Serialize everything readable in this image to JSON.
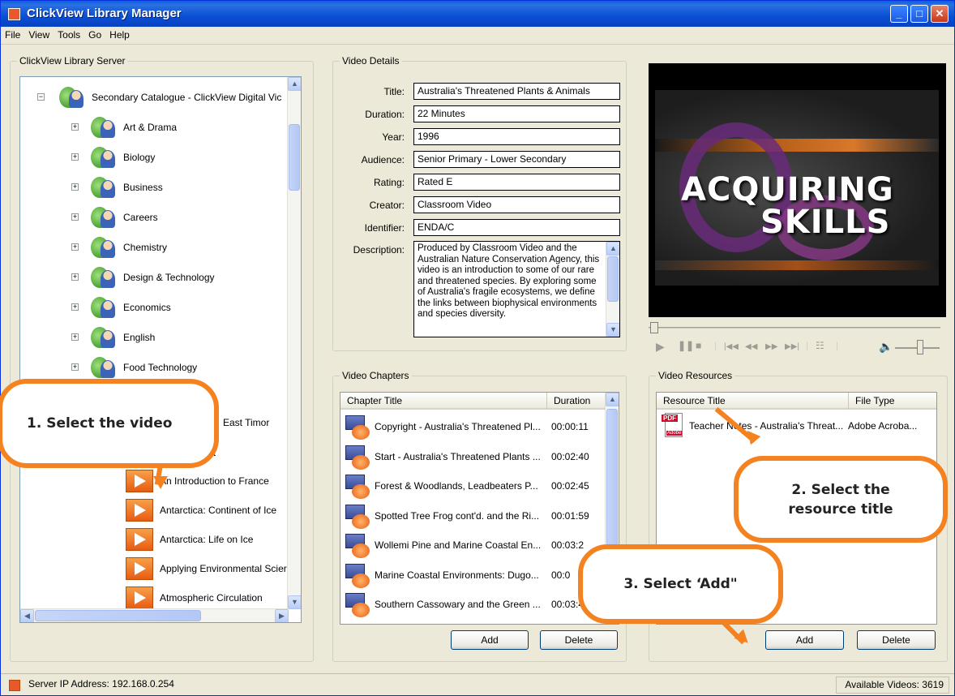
{
  "window": {
    "title": "ClickView Library Manager"
  },
  "menu": [
    "File",
    "View",
    "Tools",
    "Go",
    "Help"
  ],
  "library": {
    "legend": "ClickView Library Server",
    "root": "Secondary Catalogue - ClickView Digital Vic",
    "categories": [
      "Art & Drama",
      "Biology",
      "Business",
      "Careers",
      "Chemistry",
      "Design & Technology",
      "Economics",
      "English",
      "Food Technology"
    ],
    "partial_items": [
      "East Timor",
      "ainforest"
    ],
    "videos": [
      "An Introduction to France",
      "Antarctica: Continent of Ice",
      "Antarctica: Life on Ice",
      "Applying Environmental Scier",
      "Atmospheric Circulation"
    ]
  },
  "details": {
    "legend": "Video Details",
    "fields": [
      {
        "label": "Title:",
        "value": "Australia's Threatened Plants & Animals"
      },
      {
        "label": "Duration:",
        "value": "22 Minutes"
      },
      {
        "label": "Year:",
        "value": "1996"
      },
      {
        "label": "Audience:",
        "value": "Senior Primary - Lower Secondary"
      },
      {
        "label": "Rating:",
        "value": "Rated E"
      },
      {
        "label": "Creator:",
        "value": "Classroom Video"
      },
      {
        "label": "Identifier:",
        "value": "ENDA/C"
      }
    ],
    "description_label": "Description:",
    "description": "Produced by Classroom Video and the Australian Nature Conservation Agency, this video is an introduction to some of our rare and threatened species. By exploring some of Australia's fragile ecosystems, we define the links between biophysical environments and species diversity."
  },
  "player": {
    "line1": "ACQUIRING",
    "line2": "SKILLS"
  },
  "chapters": {
    "legend": "Video Chapters",
    "col_title": "Chapter Title",
    "col_duration": "Duration",
    "rows": [
      {
        "title": "Copyright - Australia's Threatened Pl...",
        "duration": "00:00:11"
      },
      {
        "title": "Start - Australia's Threatened Plants ...",
        "duration": "00:02:40"
      },
      {
        "title": "Forest & Woodlands, Leadbeaters P...",
        "duration": "00:02:45"
      },
      {
        "title": "Spotted Tree Frog cont'd. and the Ri...",
        "duration": "00:01:59"
      },
      {
        "title": "Wollemi Pine and Marine Coastal En...",
        "duration": "00:03:2"
      },
      {
        "title": "Marine Coastal Environments: Dugo...",
        "duration": "00:0"
      },
      {
        "title": "Southern Cassowary and the Green ...",
        "duration": "00:03:4"
      }
    ],
    "add": "Add",
    "delete": "Delete"
  },
  "resources": {
    "legend": "Video Resources",
    "col_title": "Resource Title",
    "col_type": "File Type",
    "rows": [
      {
        "title": "Teacher Notes - Australia's Threat...",
        "type": "Adobe Acroba..."
      }
    ],
    "pdf_label": "PDF",
    "adobe_label": "Adobe",
    "add": "Add",
    "delete": "Delete"
  },
  "status": {
    "server": "Server IP Address: 192.168.0.254",
    "available": "Available Videos: 3619"
  },
  "callouts": {
    "step1": "1. Select the video",
    "step2": "2. Select the resource title",
    "step3": "3. Select ‘Add\""
  },
  "colors": {
    "accent": "#f58220",
    "titlebar": "#0a4fd4"
  }
}
